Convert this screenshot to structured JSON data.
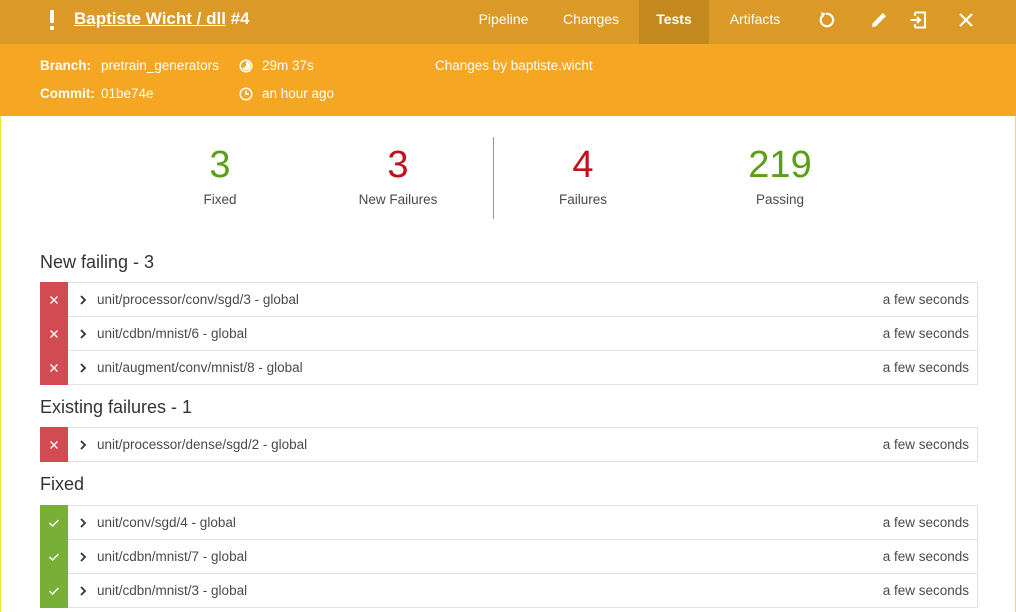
{
  "header": {
    "status_icon": "exclamation-icon",
    "title_link": "Baptiste Wicht / dll",
    "run_number": "#4",
    "tabs": [
      {
        "label": "Pipeline"
      },
      {
        "label": "Changes"
      },
      {
        "label": "Tests"
      },
      {
        "label": "Artifacts"
      }
    ],
    "active_tab": "Tests",
    "actions": [
      "replay-icon",
      "edit-icon",
      "open-in-classic-icon",
      "close-icon"
    ]
  },
  "run_info": {
    "branch_label": "Branch:",
    "branch": "pretrain_generators",
    "commit_label": "Commit:",
    "commit": "01be74e",
    "duration": "29m 37s",
    "started": "an hour ago",
    "changes": "Changes by baptiste.wicht"
  },
  "summary": [
    {
      "value": "3",
      "label": "Fixed",
      "color": "#5aa012"
    },
    {
      "value": "3",
      "label": "New Failures",
      "color": "#c0121b"
    },
    {
      "value": "4",
      "label": "Failures",
      "color": "#c0121b"
    },
    {
      "value": "219",
      "label": "Passing",
      "color": "#5aa012"
    }
  ],
  "sections": {
    "new_failing": {
      "title": "New failing - 3",
      "rows": [
        {
          "name": "unit/processor/conv/sgd/3 - global",
          "duration": "a few seconds"
        },
        {
          "name": "unit/cdbn/mnist/6 - global",
          "duration": "a few seconds"
        },
        {
          "name": "unit/augment/conv/mnist/8 - global",
          "duration": "a few seconds"
        }
      ]
    },
    "existing_failures": {
      "title": "Existing failures - 1",
      "rows": [
        {
          "name": "unit/processor/dense/sgd/2 - global",
          "duration": "a few seconds"
        }
      ]
    },
    "fixed": {
      "title": "Fixed",
      "rows": [
        {
          "name": "unit/conv/sgd/4 - global",
          "duration": "a few seconds"
        },
        {
          "name": "unit/cdbn/mnist/7 - global",
          "duration": "a few seconds"
        },
        {
          "name": "unit/cdbn/mnist/3 - global",
          "duration": "a few seconds"
        }
      ]
    }
  },
  "colors": {
    "topbar": "#db9a28",
    "subheader": "#f5a623",
    "active_tab": "#c3891f",
    "fail": "#d24a52",
    "pass": "#78b037"
  }
}
